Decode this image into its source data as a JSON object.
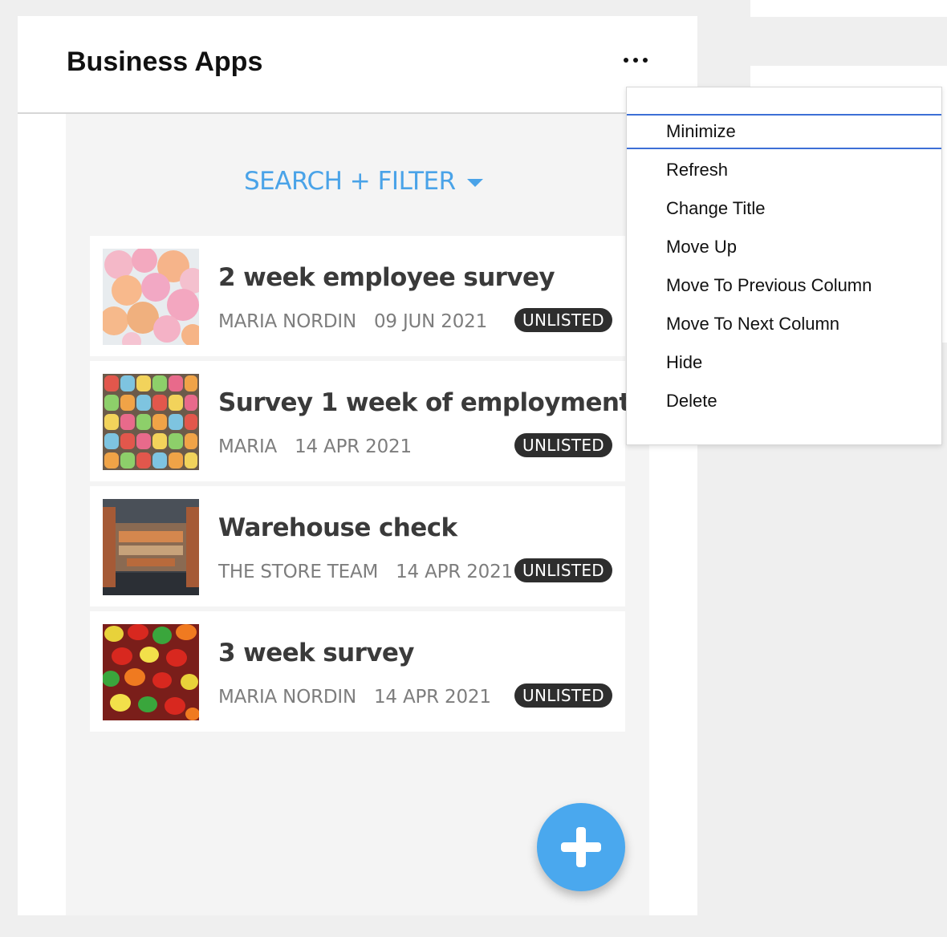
{
  "panel": {
    "title": "Business Apps",
    "more_icon": "more-horizontal-icon"
  },
  "search_filter": {
    "label": "SEARCH + FILTER",
    "icon": "caret-down-icon",
    "color": "#4aa3e8"
  },
  "items": [
    {
      "title": "2 week employee survey",
      "author": "MARIA NORDIN",
      "date": "09 JUN 2021",
      "badge": "UNLISTED",
      "thumb": "pink-orange-balloons-image"
    },
    {
      "title": "Survey 1 week of employment",
      "author": "MARIA",
      "date": "14 APR 2021",
      "badge": "UNLISTED",
      "thumb": "gummy-bears-grid-image"
    },
    {
      "title": "Warehouse check",
      "author": "THE STORE TEAM",
      "date": "14 APR 2021",
      "badge": "UNLISTED",
      "thumb": "container-ship-image"
    },
    {
      "title": "3 week survey",
      "author": "MARIA NORDIN",
      "date": "14 APR 2021",
      "badge": "UNLISTED",
      "thumb": "gummy-bears-pile-image"
    }
  ],
  "fab": {
    "icon": "plus-icon",
    "color": "#4aa8ee"
  },
  "menu": {
    "items": [
      "Minimize",
      "Refresh",
      "Change Title",
      "Move Up",
      "Move To Previous Column",
      "Move To Next Column",
      "Hide",
      "Delete"
    ],
    "active_index": 0,
    "active_color": "#3d6fd6"
  }
}
